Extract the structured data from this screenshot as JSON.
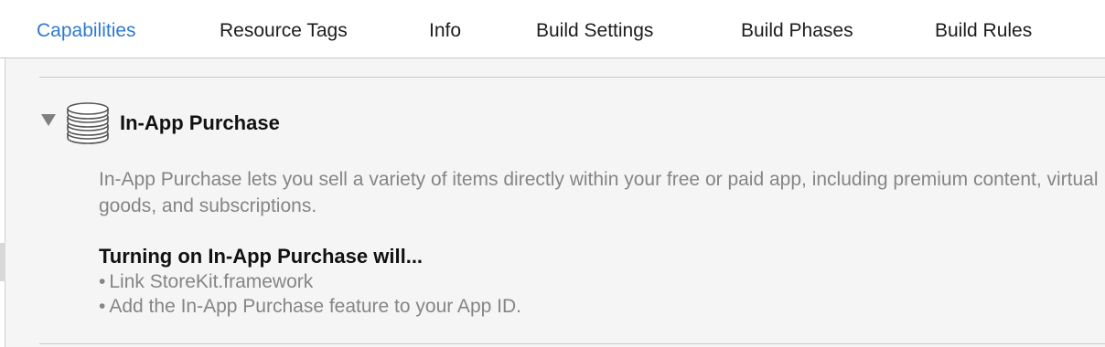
{
  "tabs": [
    {
      "label": "Capabilities",
      "active": true
    },
    {
      "label": "Resource Tags",
      "active": false
    },
    {
      "label": "Info",
      "active": false
    },
    {
      "label": "Build Settings",
      "active": false
    },
    {
      "label": "Build Phases",
      "active": false
    },
    {
      "label": "Build Rules",
      "active": false
    }
  ],
  "colors": {
    "accent": "#2f7ad1",
    "background": "#f5f5f5",
    "secondary_text": "#858585"
  },
  "capability": {
    "icon": "coins-stack-icon",
    "disclosure_icon": "disclosure-triangle-down-icon",
    "title": "In-App Purchase",
    "description": "In-App Purchase lets you sell a variety of items directly within your free or paid app, including premium content, virtual goods, and subscriptions.",
    "effects_heading": "Turning on In-App Purchase will...",
    "effects": [
      "Link StoreKit.framework",
      "Add the In-App Purchase feature to your App ID."
    ],
    "bullet_glyph": "•"
  }
}
